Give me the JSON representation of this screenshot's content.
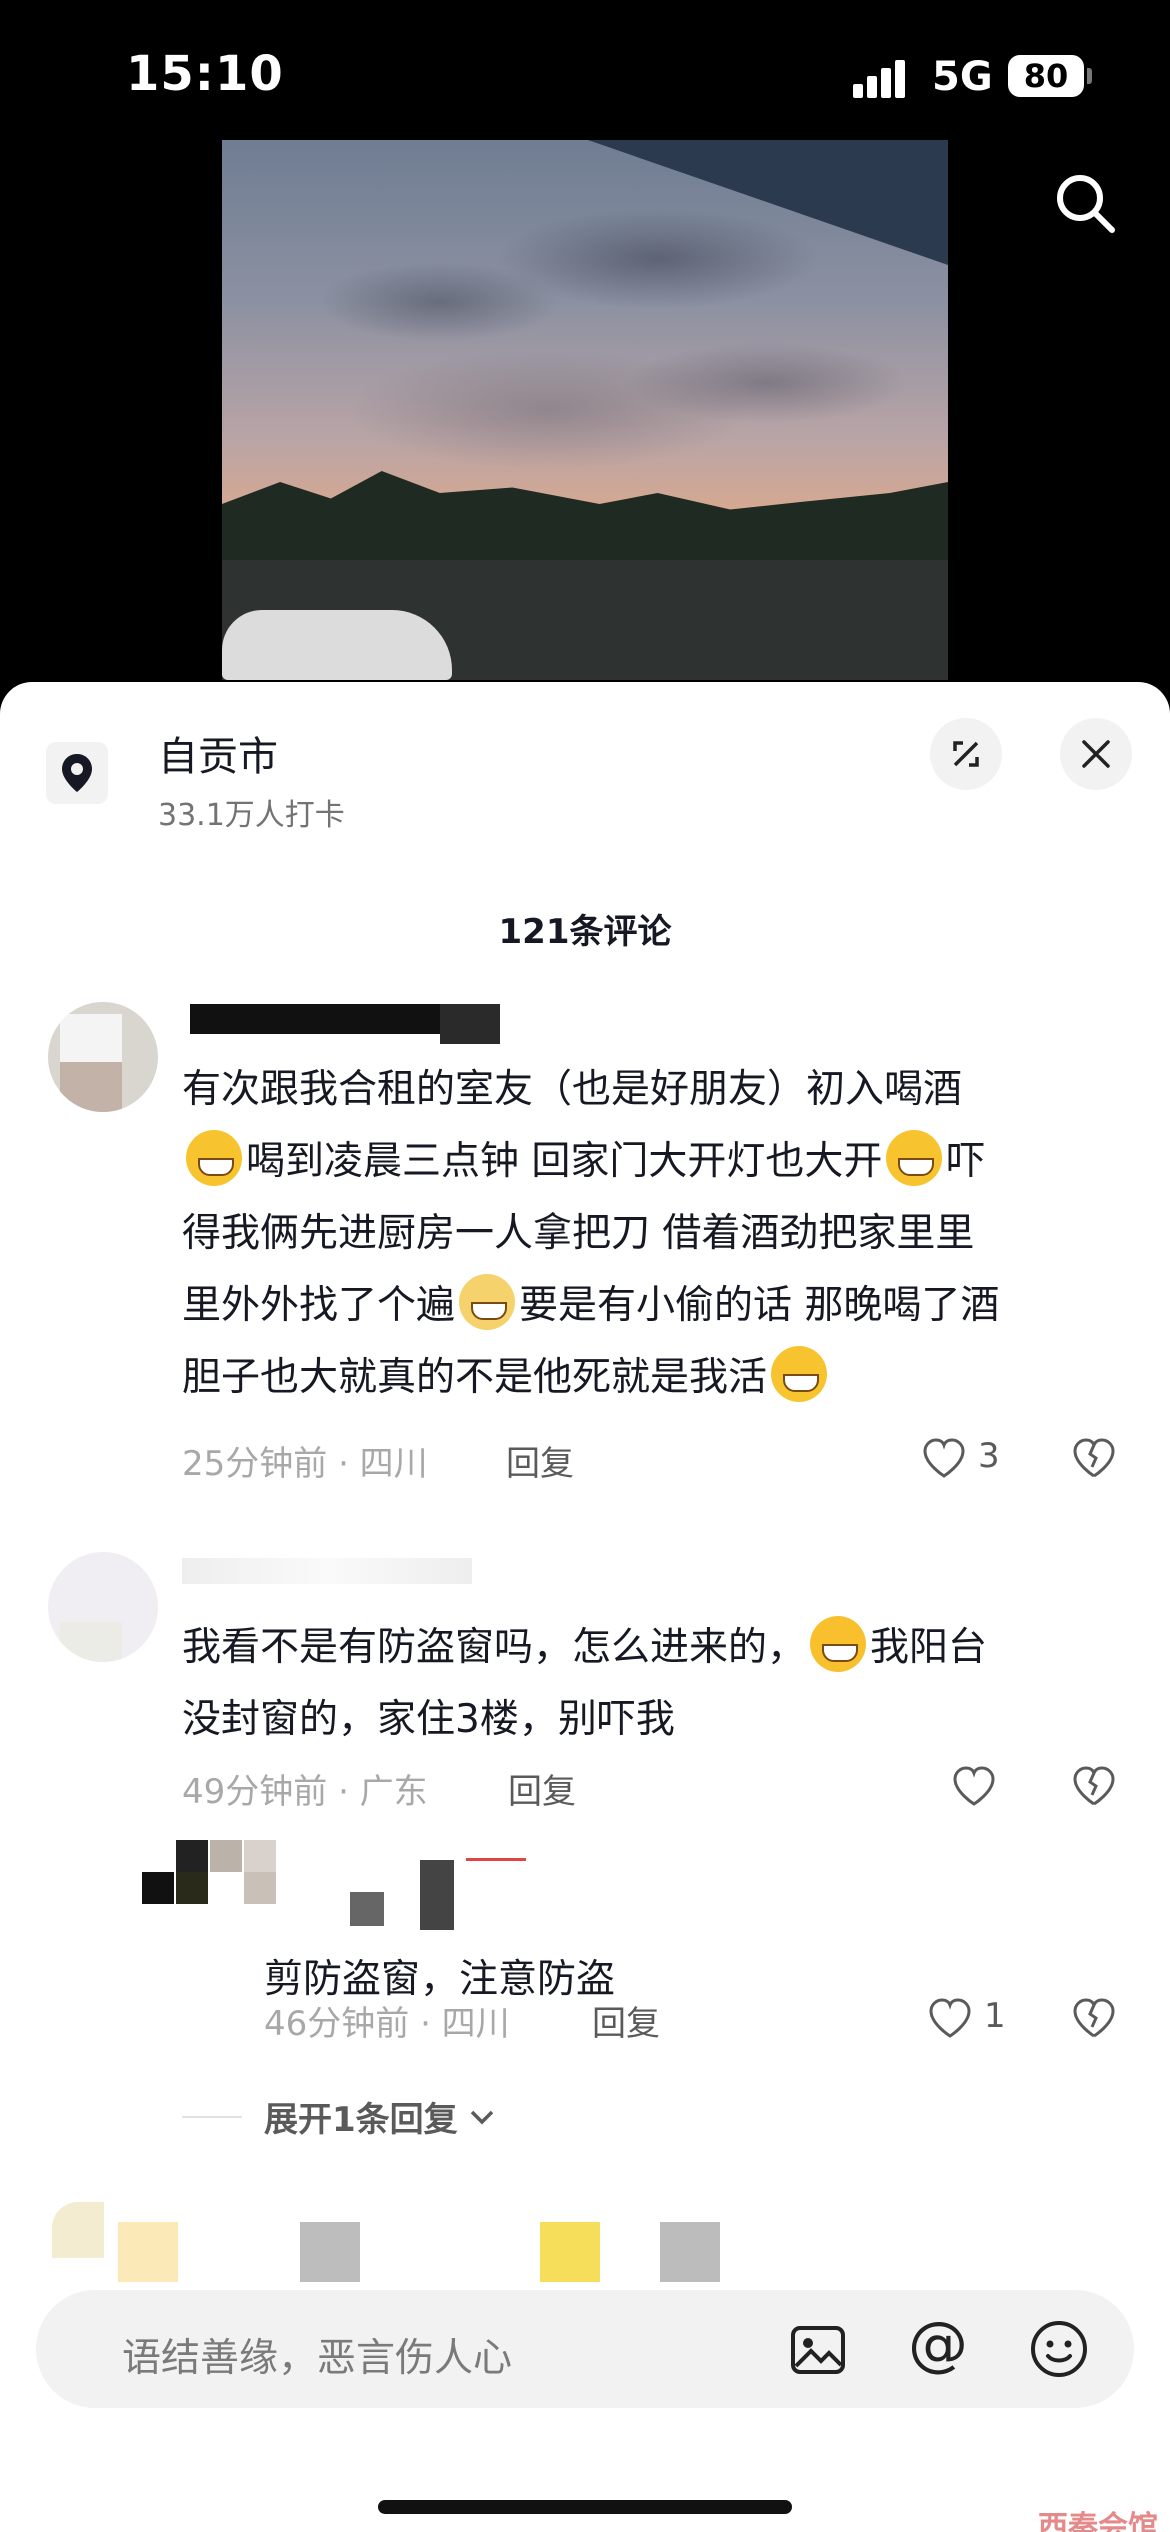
{
  "status_bar": {
    "time": "15:10",
    "network": "5G",
    "battery": "80"
  },
  "location": {
    "name": "自贡市",
    "stats": "33.1万人打卡"
  },
  "comments_header": {
    "count_label": "121条评论"
  },
  "comments": [
    {
      "text": "有次跟我合租的室友（也是好朋友）初入喝酒😅喝到凌晨三点钟  回家门大开灯也大开😅吓得我俩先进厨房一人拿把刀  借着酒劲把家里里里外外找了个遍😲要是有小偷的话  那晚喝了酒胆子也大就真的不是他死就是我活🤪",
      "line1": "有次跟我合租的室友（也是好朋友）初入喝酒",
      "line2a": "喝到凌晨三点钟  回家门大开灯也大开",
      "line2b": "吓",
      "line3": "得我俩先进厨房一人拿把刀  借着酒劲把家里里",
      "line4a": "里外外找了个遍",
      "line4b": "要是有小偷的话  那晚喝了酒",
      "line5": "胆子也大就真的不是他死就是我活",
      "time_location": "25分钟前 · 四川",
      "reply_label": "回复",
      "likes": "3"
    },
    {
      "line1a": "我看不是有防盗窗吗，怎么进来的，",
      "line1b": "我阳台",
      "line2": "没封窗的，家住3楼，别吓我",
      "time_location": "49分钟前 · 广东",
      "reply_label": "回复",
      "likes": ""
    }
  ],
  "replies": [
    {
      "text": "剪防盗窗，注意防盗",
      "time_location": "46分钟前 · 四川",
      "reply_label": "回复",
      "likes": "1"
    }
  ],
  "expand_replies_label": "展开1条回复",
  "input": {
    "placeholder": "语结善缘，恶言伤人心"
  },
  "watermark": "西秦会馆",
  "icons": [
    "search-icon",
    "location-pin-icon",
    "expand-icon",
    "close-icon",
    "heart-icon",
    "broken-heart-icon",
    "image-icon",
    "at-icon",
    "emoji-icon",
    "chevron-down-icon"
  ]
}
